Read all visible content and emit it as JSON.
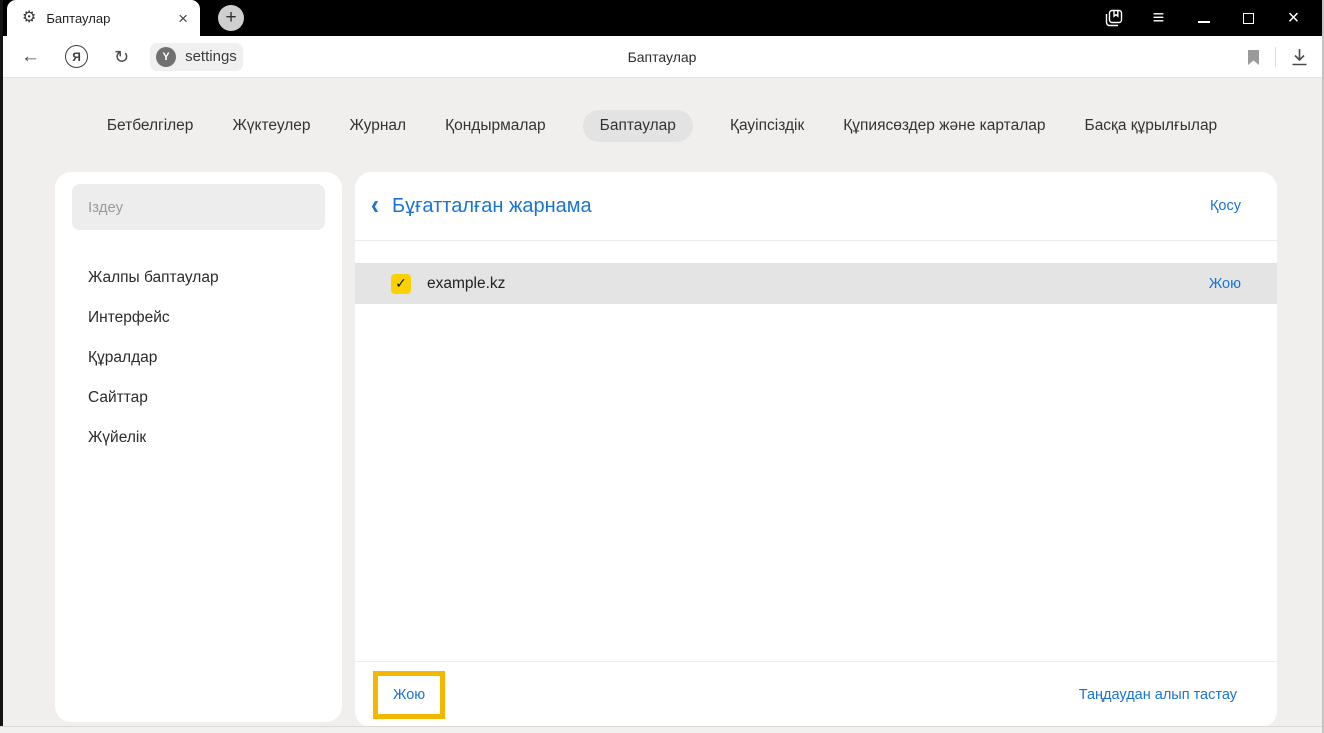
{
  "browser": {
    "tab": {
      "title": "Баптаулар"
    },
    "page_title": "Баптаулар",
    "address": "settings",
    "icons": {
      "gear": "⚙",
      "tab_close": "×",
      "new_tab": "+",
      "menu": "≡",
      "maximize": "css-box",
      "minimize": "css-line",
      "window_close": "×",
      "tabs_panel": "svg-shape",
      "back": "←",
      "yandex_logo": "Я",
      "refresh": "↻",
      "protect": "Y",
      "bookmark": "svg-flag",
      "download": "svg-arrow"
    }
  },
  "nav": {
    "tabs": [
      {
        "label": "Бетбелгілер",
        "active": false
      },
      {
        "label": "Жүктеулер",
        "active": false
      },
      {
        "label": "Журнал",
        "active": false
      },
      {
        "label": "Қондырмалар",
        "active": false
      },
      {
        "label": "Баптаулар",
        "active": true
      },
      {
        "label": "Қауіпсіздік",
        "active": false
      },
      {
        "label": "Құпиясөздер және карталар",
        "active": false
      },
      {
        "label": "Басқа құрылғылар",
        "active": false
      }
    ]
  },
  "sidebar": {
    "search_placeholder": "Іздеу",
    "items": [
      {
        "label": "Жалпы баптаулар"
      },
      {
        "label": "Интерфейс"
      },
      {
        "label": "Құралдар"
      },
      {
        "label": "Сайттар"
      },
      {
        "label": "Жүйелік"
      }
    ]
  },
  "main": {
    "back_icon": "‹",
    "title": "Бұғатталған жарнама",
    "add_label": "Қосу",
    "list": [
      {
        "checked": true,
        "check_glyph": "✓",
        "domain": "example.kz",
        "remove_label": "Жою"
      }
    ],
    "footer": {
      "delete_label": "Жою",
      "deselect_label": "Таңдаудан алып тастау"
    }
  },
  "colors": {
    "accent_blue": "#1a74d4",
    "selection_yellow": "#fdd000",
    "highlight_gold": "#f3b700",
    "row_gray": "#e4e4e4"
  }
}
